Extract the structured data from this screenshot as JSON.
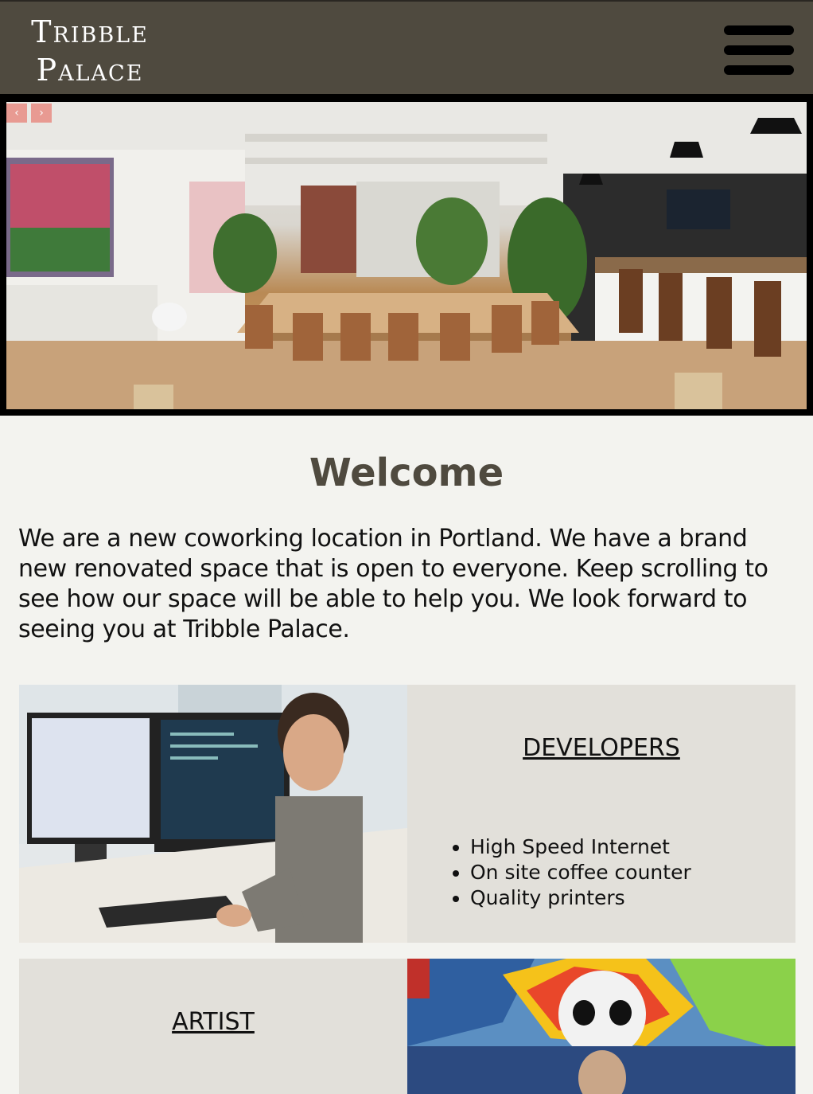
{
  "header": {
    "logo_line1": "Tribble",
    "logo_line2": "Palace",
    "menu_icon": "hamburger-menu-icon",
    "color": "#4f4a3f"
  },
  "hero": {
    "prev_label": "‹",
    "next_label": "›",
    "accent": "#e8928a"
  },
  "main": {
    "title": "Welcome",
    "intro": "We are a new coworking location in Portland. We have a brand new renovated space that is open to everyone. Keep scrolling to see how our space will be able to help you. We look forward to seeing you at Tribble Palace."
  },
  "cards": {
    "developers": {
      "title": "DEVELOPERS",
      "features": [
        "High Speed Internet",
        "On site coffee counter",
        "Quality printers"
      ]
    },
    "artist": {
      "title": "ARTIST"
    }
  }
}
